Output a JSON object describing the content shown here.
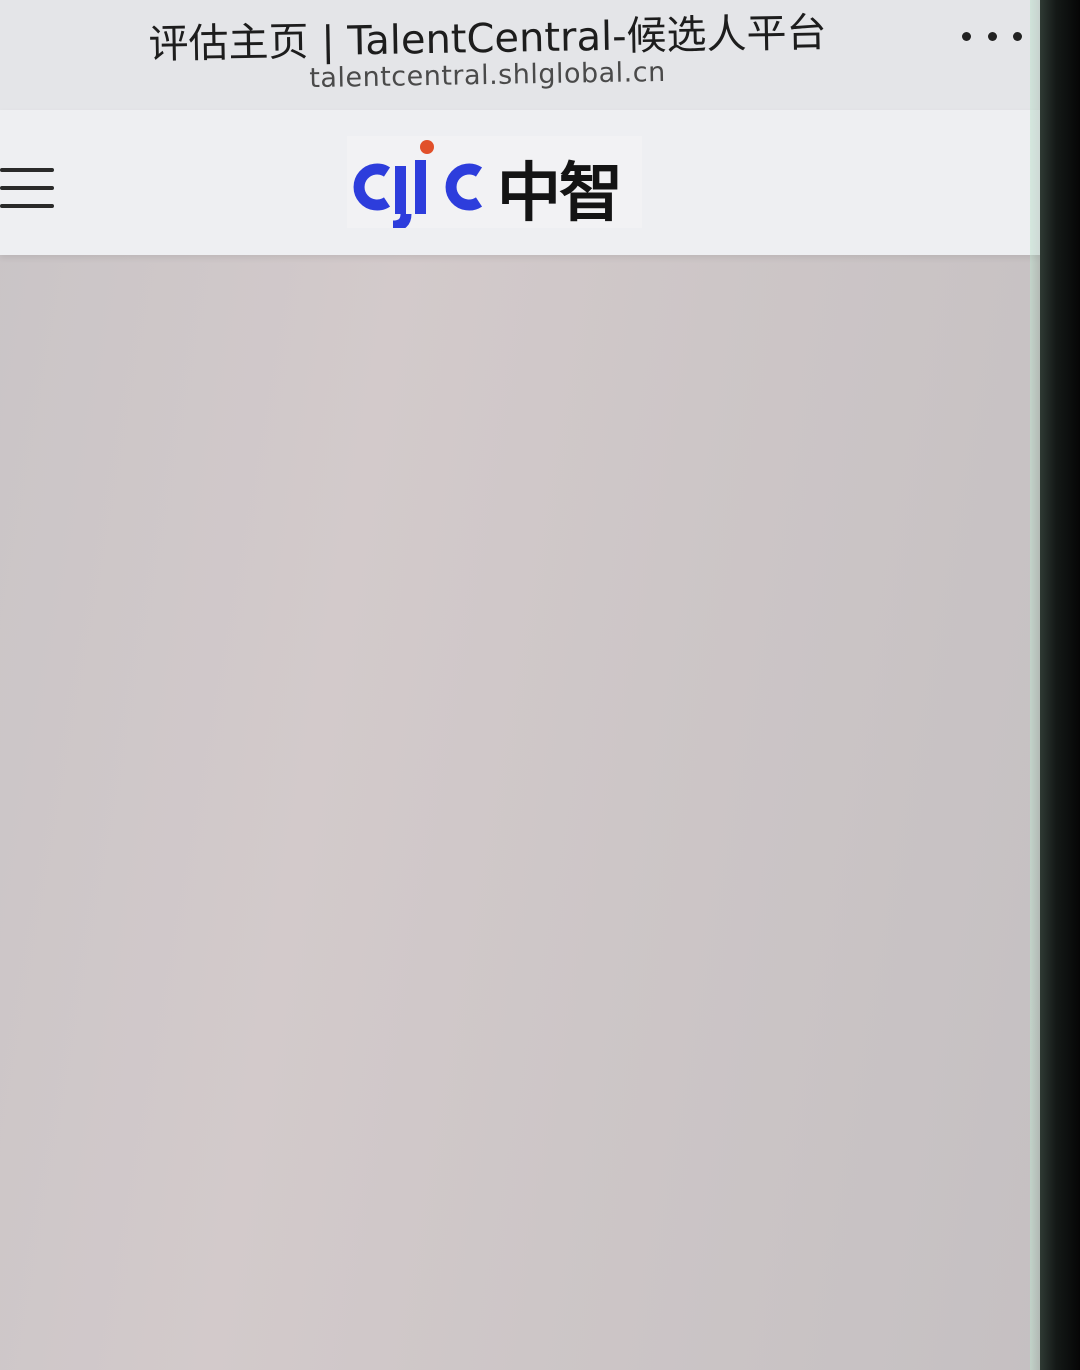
{
  "browser": {
    "title": "评估主页 | TalentCentral-候选人平台",
    "url": "talentcentral.shlglobal.cn"
  },
  "header": {
    "logo_text_en": "cjic",
    "logo_text_cn": "中智"
  },
  "colors": {
    "logo_blue": "#2d3ddc",
    "logo_dot": "#e1502a",
    "header_bg": "#eeeff2",
    "content_bg": "#cdc6c7"
  },
  "icons": {
    "menu": "hamburger-menu-icon",
    "more": "more-options-icon"
  }
}
